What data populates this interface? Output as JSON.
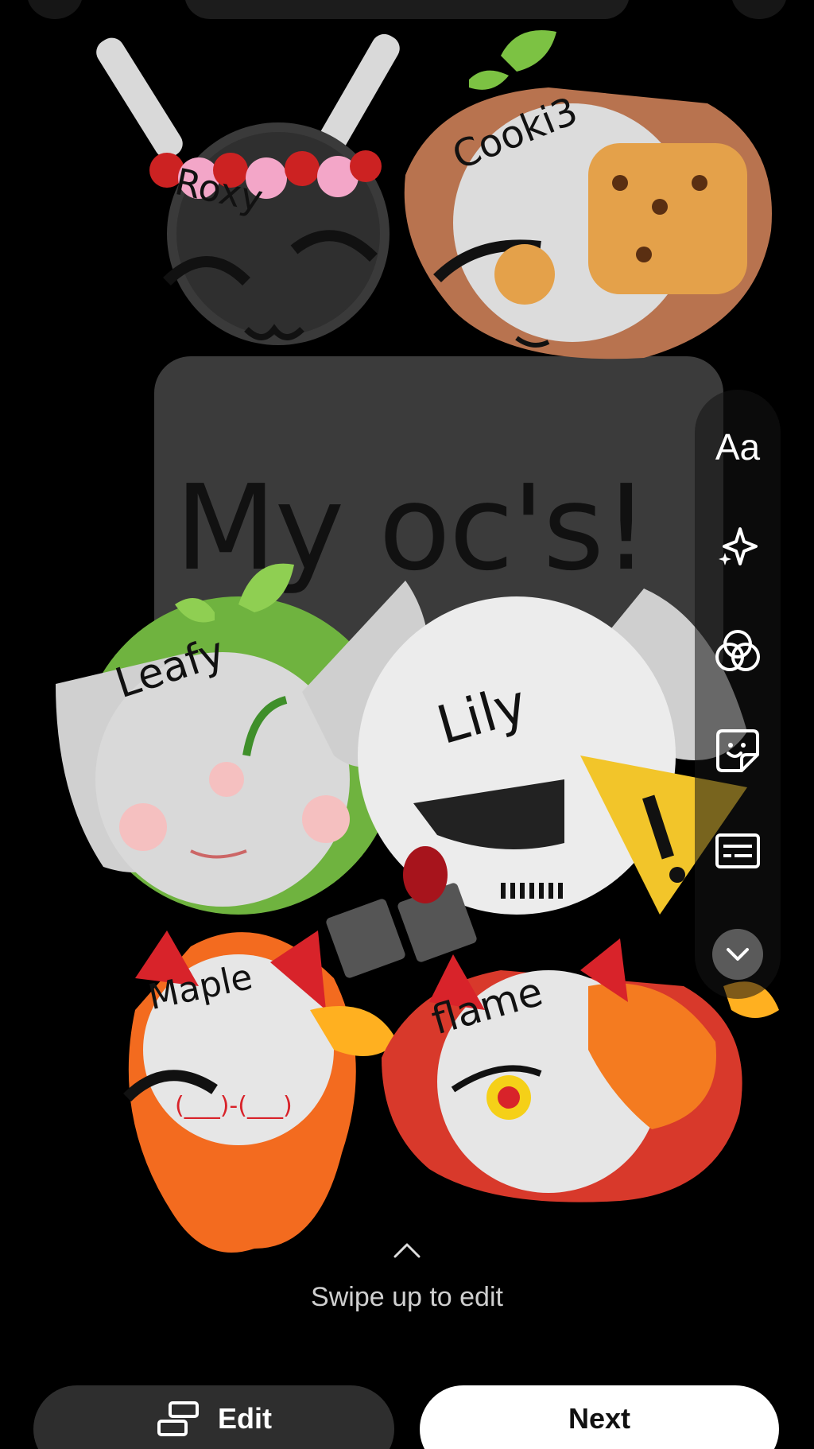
{
  "canvas": {
    "headline": "My oc's!"
  },
  "stickers": [
    {
      "name": "Roxy"
    },
    {
      "name": "Cooki3"
    },
    {
      "name": "Leafy"
    },
    {
      "name": "Lily"
    },
    {
      "name": "Maple"
    },
    {
      "name": "flame"
    }
  ],
  "tool_rail": {
    "items": [
      {
        "label": "Aa",
        "icon": "text-icon"
      },
      {
        "label": "",
        "icon": "sparkle-icon"
      },
      {
        "label": "",
        "icon": "color-filter-icon"
      },
      {
        "label": "",
        "icon": "sticker-icon"
      },
      {
        "label": "",
        "icon": "caption-icon"
      },
      {
        "label": "",
        "icon": "chevron-down-icon"
      }
    ]
  },
  "hint": {
    "swipe_text": "Swipe up to edit"
  },
  "actions": {
    "edit_label": "Edit",
    "next_label": "Next"
  },
  "colors": {
    "background": "#000000",
    "card": "#3b3b3b",
    "next_button": "#ffffff",
    "edit_button": "#2e2e2e"
  }
}
